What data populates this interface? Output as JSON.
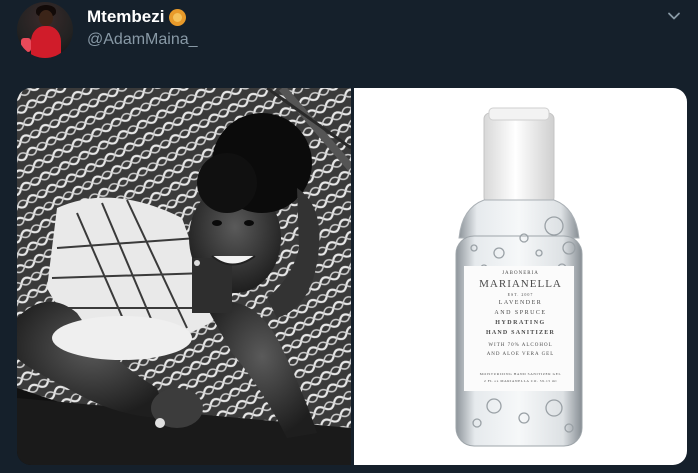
{
  "header": {
    "display_name": "Mtembezi",
    "handle": "@AdamMaina_",
    "name_emoji_icon": "lion-face-icon"
  },
  "media": {
    "bottle_label": {
      "brand_small": "JABONERIA",
      "brand": "MARIANELLA",
      "est": "EST. 2007",
      "line1": "LAVENDER",
      "line2": "AND SPRUCE",
      "line3": "HYDRATING",
      "line4": "HAND SANITIZER",
      "line5": "WITH 70% ALCOHOL",
      "line6": "AND ALOE VERA GEL",
      "footer1": "MOISTURIZING HAND SANITIZER GEL",
      "footer2": "2 FL oz   MARIANELLA CO.   59.15 ml"
    }
  },
  "colors": {
    "background": "#15202b",
    "handle": "#8899a6",
    "avatar_shirt": "#d01c2a"
  }
}
